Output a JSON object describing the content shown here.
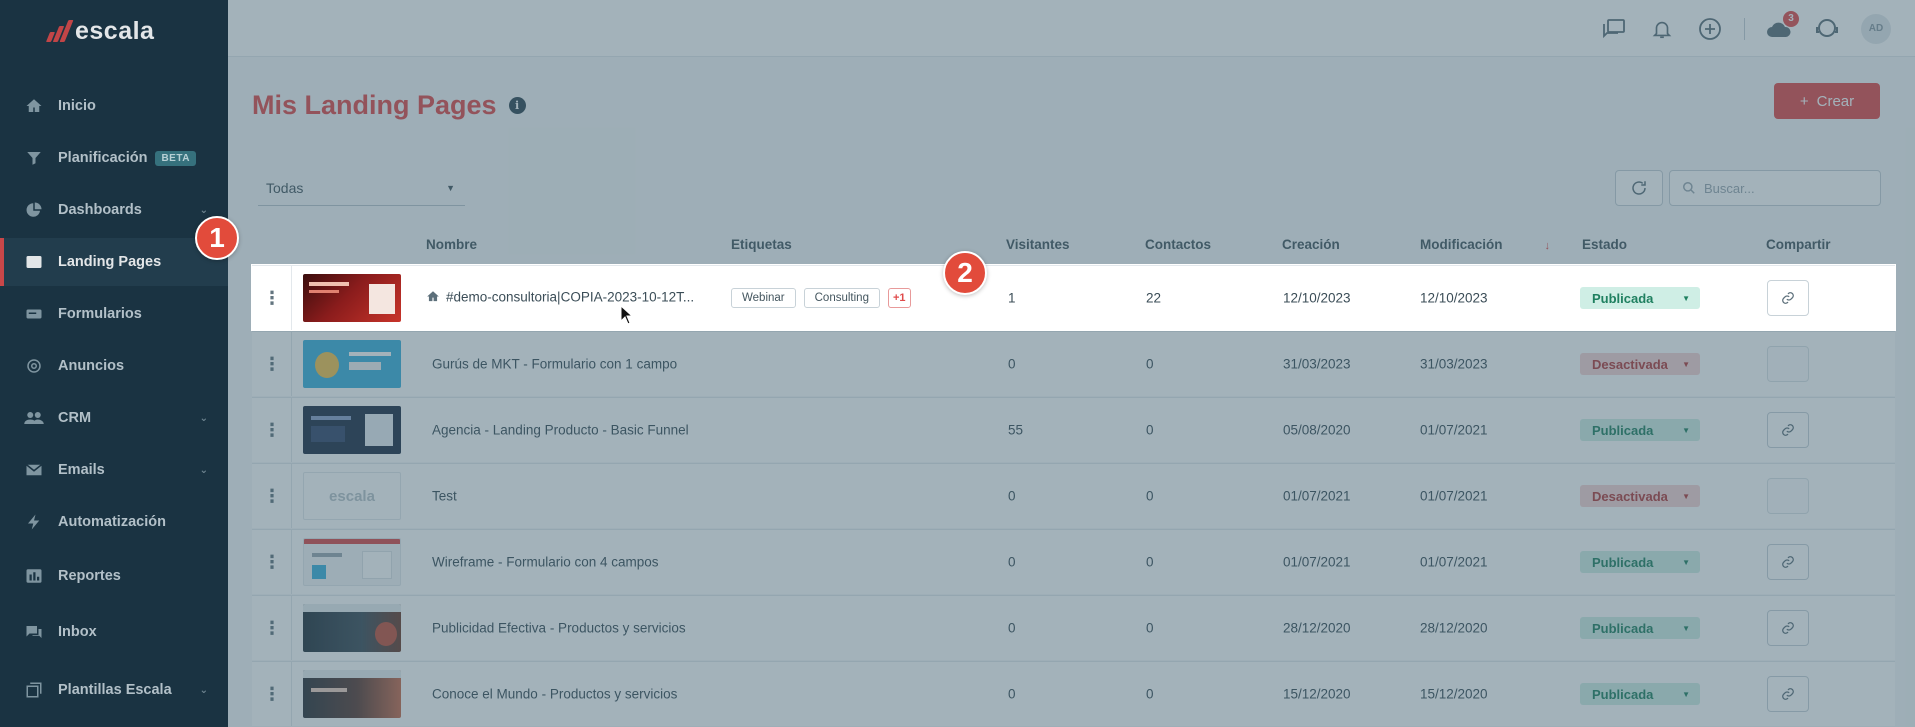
{
  "app": {
    "logo_text": "escala"
  },
  "sidebar": {
    "items": [
      {
        "label": "Inicio",
        "icon": "home-icon"
      },
      {
        "label": "Planificación",
        "icon": "funnel-icon",
        "badge": "BETA"
      },
      {
        "label": "Dashboards",
        "icon": "pie-chart-icon"
      },
      {
        "label": "Landing Pages",
        "icon": "landing-page-icon",
        "active": true
      },
      {
        "label": "Formularios",
        "icon": "form-icon"
      },
      {
        "label": "Anuncios",
        "icon": "megaphone-icon"
      },
      {
        "label": "CRM",
        "icon": "people-icon"
      },
      {
        "label": "Emails",
        "icon": "mail-icon"
      },
      {
        "label": "Automatización",
        "icon": "lightning-icon"
      },
      {
        "label": "Reportes",
        "icon": "bar-chart-icon"
      },
      {
        "label": "Inbox",
        "icon": "chat-icon"
      },
      {
        "label": "Plantillas Escala",
        "icon": "templates-icon"
      }
    ]
  },
  "header": {
    "icons": [
      "messages-icon",
      "bell-icon",
      "plus-circle-icon",
      "cloud-icon",
      "support-icon"
    ],
    "notification_count": "3",
    "avatar_initials": "AD"
  },
  "main": {
    "title": "Mis Landing Pages",
    "create_label": "Crear",
    "filter_value": "Todas",
    "search_placeholder": "Buscar...",
    "columns": {
      "nombre": "Nombre",
      "etiquetas": "Etiquetas",
      "visitantes": "Visitantes",
      "contactos": "Contactos",
      "creacion": "Creación",
      "modificacion": "Modificación",
      "estado": "Estado",
      "compartir": "Compartir"
    },
    "rows": [
      {
        "name": "#demo-consultoria|COPIA-2023-10-12T...",
        "home": true,
        "tags": [
          "Webinar",
          "Consulting"
        ],
        "more_tags": "+1",
        "visitors": "1",
        "contacts": "22",
        "created": "12/10/2023",
        "modified": "12/10/2023",
        "status": "Publicada",
        "highlight": true
      },
      {
        "name": "Gurús de MKT - Formulario con 1 campo",
        "tags": [],
        "visitors": "0",
        "contacts": "0",
        "created": "31/03/2023",
        "modified": "31/03/2023",
        "status": "Desactivada"
      },
      {
        "name": "Agencia - Landing Producto - Basic Funnel",
        "tags": [],
        "visitors": "55",
        "contacts": "0",
        "created": "05/08/2020",
        "modified": "01/07/2021",
        "status": "Publicada"
      },
      {
        "name": "Test",
        "thumb_text": "escala",
        "tags": [],
        "visitors": "0",
        "contacts": "0",
        "created": "01/07/2021",
        "modified": "01/07/2021",
        "status": "Desactivada"
      },
      {
        "name": "Wireframe - Formulario con 4 campos",
        "tags": [],
        "visitors": "0",
        "contacts": "0",
        "created": "01/07/2021",
        "modified": "01/07/2021",
        "status": "Publicada"
      },
      {
        "name": "Publicidad Efectiva - Productos y servicios",
        "tags": [],
        "visitors": "0",
        "contacts": "0",
        "created": "28/12/2020",
        "modified": "28/12/2020",
        "status": "Publicada"
      },
      {
        "name": "Conoce el Mundo - Productos y servicios",
        "tags": [],
        "visitors": "0",
        "contacts": "0",
        "created": "15/12/2020",
        "modified": "15/12/2020",
        "status": "Publicada"
      }
    ]
  },
  "tutorial": {
    "marker_1": "1",
    "marker_2": "2"
  },
  "colors": {
    "brand": "#e04a4a",
    "sidebar": "#1b3442",
    "published": "#cfeee5",
    "disabled": "#f6d3d3"
  }
}
